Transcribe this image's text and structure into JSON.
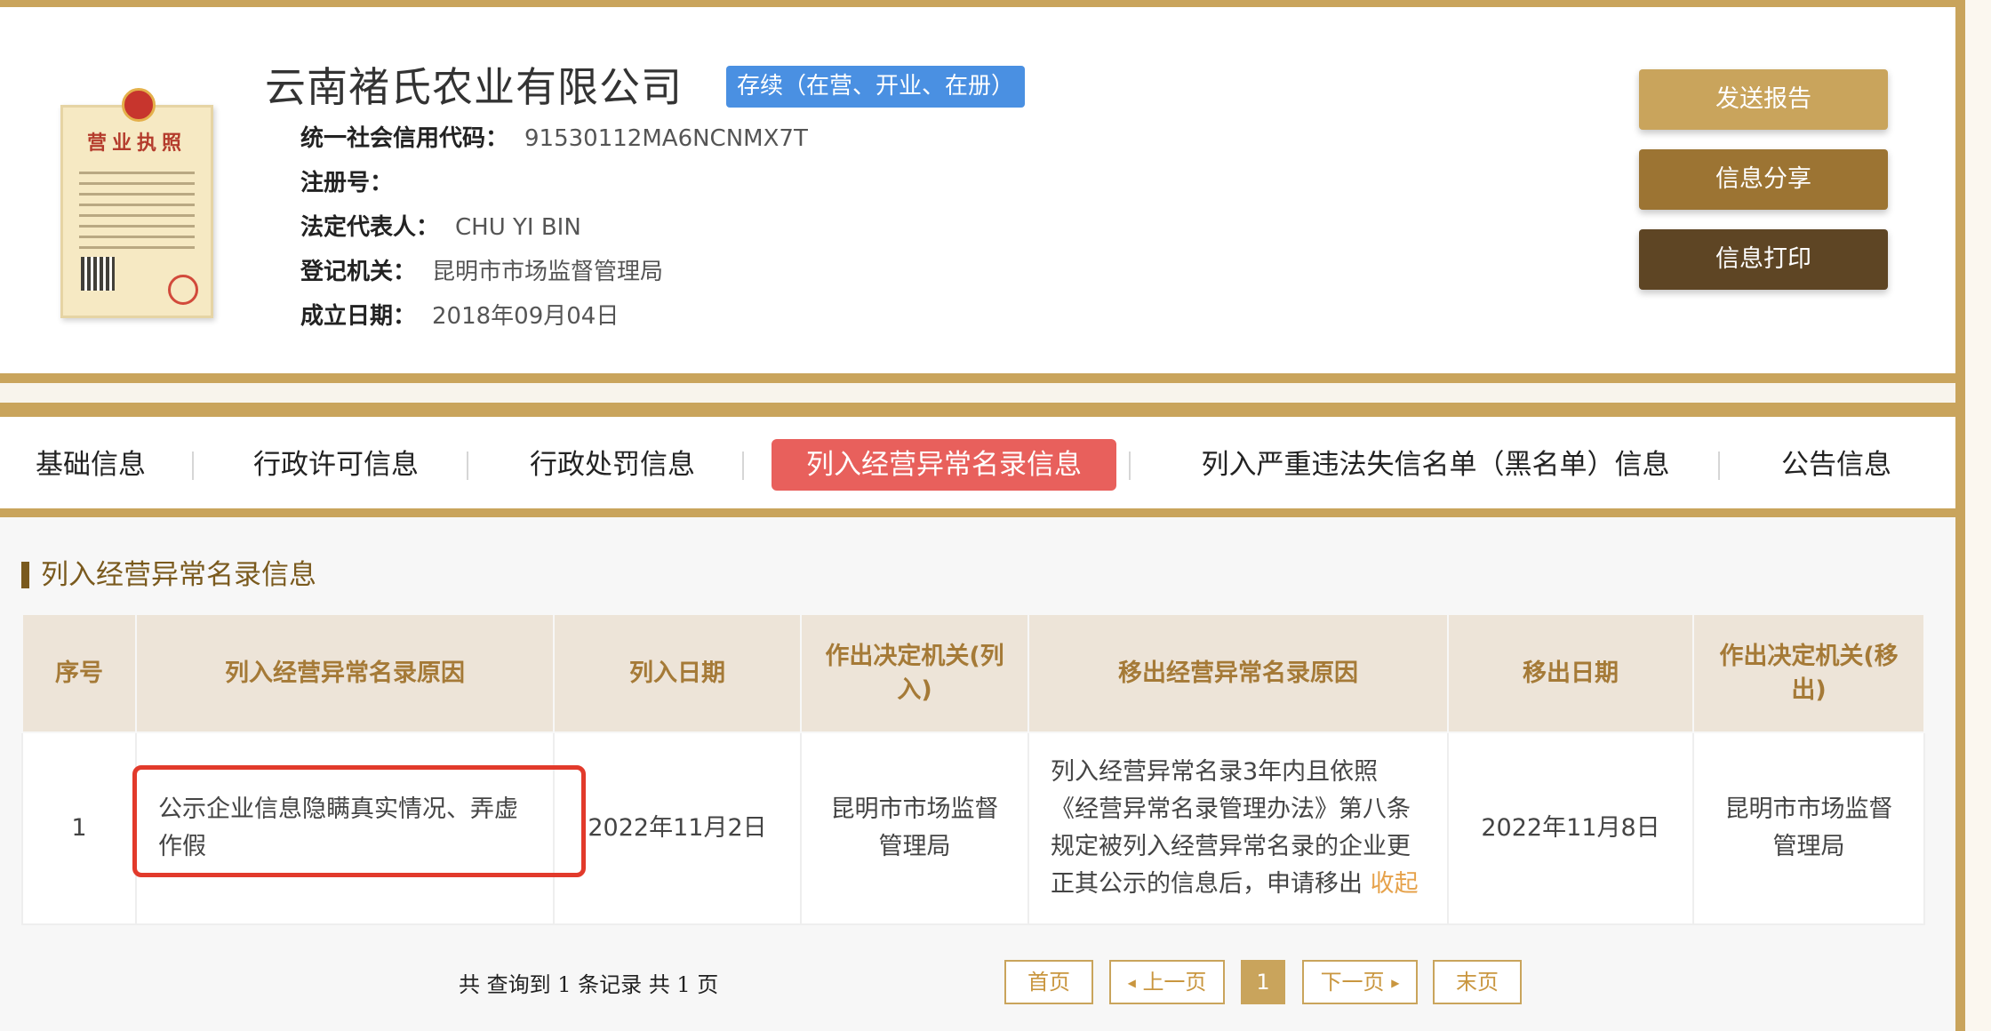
{
  "company": {
    "name": "云南褚氏农业有限公司",
    "status": "存续（在营、开业、在册）",
    "license_title": "营业执照",
    "fields": [
      {
        "label": "统一社会信用代码：",
        "value": "91530112MA6NCNMX7T"
      },
      {
        "label": "注册号：",
        "value": ""
      },
      {
        "label": "法定代表人：",
        "value": "CHU YI BIN"
      },
      {
        "label": "登记机关：",
        "value": "昆明市市场监督管理局"
      },
      {
        "label": "成立日期：",
        "value": "2018年09月04日"
      }
    ]
  },
  "actions": {
    "send_report": "发送报告",
    "share": "信息分享",
    "print": "信息打印"
  },
  "tabs": [
    {
      "label": "基础信息"
    },
    {
      "label": "行政许可信息"
    },
    {
      "label": "行政处罚信息"
    },
    {
      "label": "列入经营异常名录信息"
    },
    {
      "label": "列入严重违法失信名单（黑名单）信息"
    },
    {
      "label": "公告信息"
    }
  ],
  "section": {
    "title": "列入经营异常名录信息"
  },
  "table": {
    "headers": [
      "序号",
      "列入经营异常名录原因",
      "列入日期",
      "作出决定机关(列入)",
      "移出经营异常名录原因",
      "移出日期",
      "作出决定机关(移出)"
    ],
    "rows": [
      {
        "index": "1",
        "reason": "公示企业信息隐瞒真实情况、弄虚作假",
        "date_in": "2022年11月2日",
        "authority_in": "昆明市市场监督管理局",
        "removal_reason": "列入经营异常名录3年内且依照《经营异常名录管理办法》第八条规定被列入经营异常名录的企业更正其公示的信息后，申请移出",
        "collapse_label": "收起",
        "date_out": "2022年11月8日",
        "authority_out": "昆明市市场监督管理局"
      }
    ]
  },
  "pagination": {
    "summary": "共 查询到 1 条记录 共 1 页",
    "first": "首页",
    "prev": "上一页",
    "current": "1",
    "next": "下一页",
    "last": "末页"
  },
  "colors": {
    "gold": "#c9a45c",
    "active_tab": "#e8605c",
    "status_blue": "#4a90e2",
    "btn_send": "#c9a45c",
    "btn_share": "#9c7433",
    "btn_print": "#5e4524",
    "highlight": "#e23a2b"
  }
}
